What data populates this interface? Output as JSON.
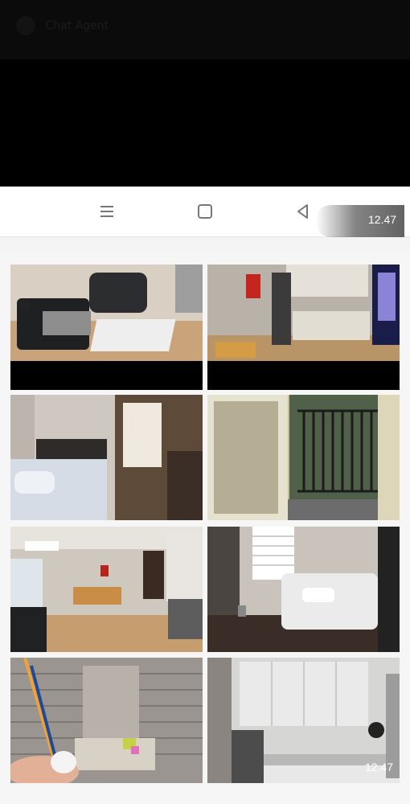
{
  "chat": {
    "title": "Chat Agent"
  },
  "navbar": {
    "menu_icon": "menu-icon",
    "home_icon": "home-square-icon",
    "back_icon": "back-triangle-icon",
    "time": "12.47"
  },
  "gallery": {
    "photos": [
      {
        "subject": "living-room-sofa"
      },
      {
        "subject": "kitchen"
      },
      {
        "subject": "bedroom"
      },
      {
        "subject": "balcony-door"
      },
      {
        "subject": "living-room-wide"
      },
      {
        "subject": "small-bedroom"
      },
      {
        "subject": "bathroom"
      },
      {
        "subject": "kitchen-cabinets"
      }
    ],
    "overlay_time": "12.47"
  },
  "colors": {
    "background": "#f4f4f4",
    "top": "#000000",
    "navbar": "#ffffff"
  }
}
